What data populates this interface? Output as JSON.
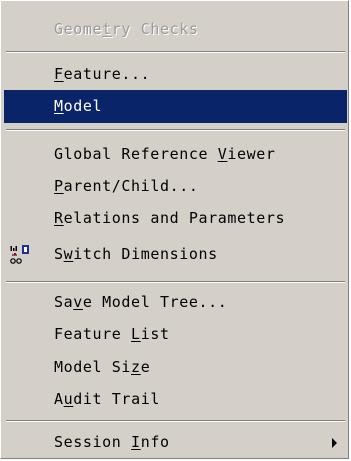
{
  "menu": {
    "items": [
      {
        "pre": "Geome",
        "key": "t",
        "post": "ry Checks",
        "disabled": true
      },
      {
        "pre": "",
        "key": "F",
        "post": "eature..."
      },
      {
        "pre": "",
        "key": "M",
        "post": "odel",
        "selected": true
      },
      {
        "pre": "Global Reference ",
        "key": "V",
        "post": "iewer"
      },
      {
        "pre": "",
        "key": "P",
        "post": "arent/Child..."
      },
      {
        "pre": "",
        "key": "R",
        "post": "elations and Parameters"
      },
      {
        "pre": "S",
        "key": "w",
        "post": "itch Dimensions",
        "icon": "switch-dimensions-icon"
      },
      {
        "pre": "Sa",
        "key": "v",
        "post": "e Model Tree..."
      },
      {
        "pre": "Feature ",
        "key": "L",
        "post": "ist"
      },
      {
        "pre": "Model Si",
        "key": "z",
        "post": "e"
      },
      {
        "pre": "A",
        "key": "u",
        "post": "dit Trail"
      },
      {
        "pre": "Session ",
        "key": "I",
        "post": "nfo",
        "submenu": true
      }
    ]
  },
  "colors": {
    "menu_background": "#d4d0c8",
    "selection_background": "#0a246a",
    "selection_text": "#ffffff",
    "disabled_text": "#9a9a9a"
  }
}
